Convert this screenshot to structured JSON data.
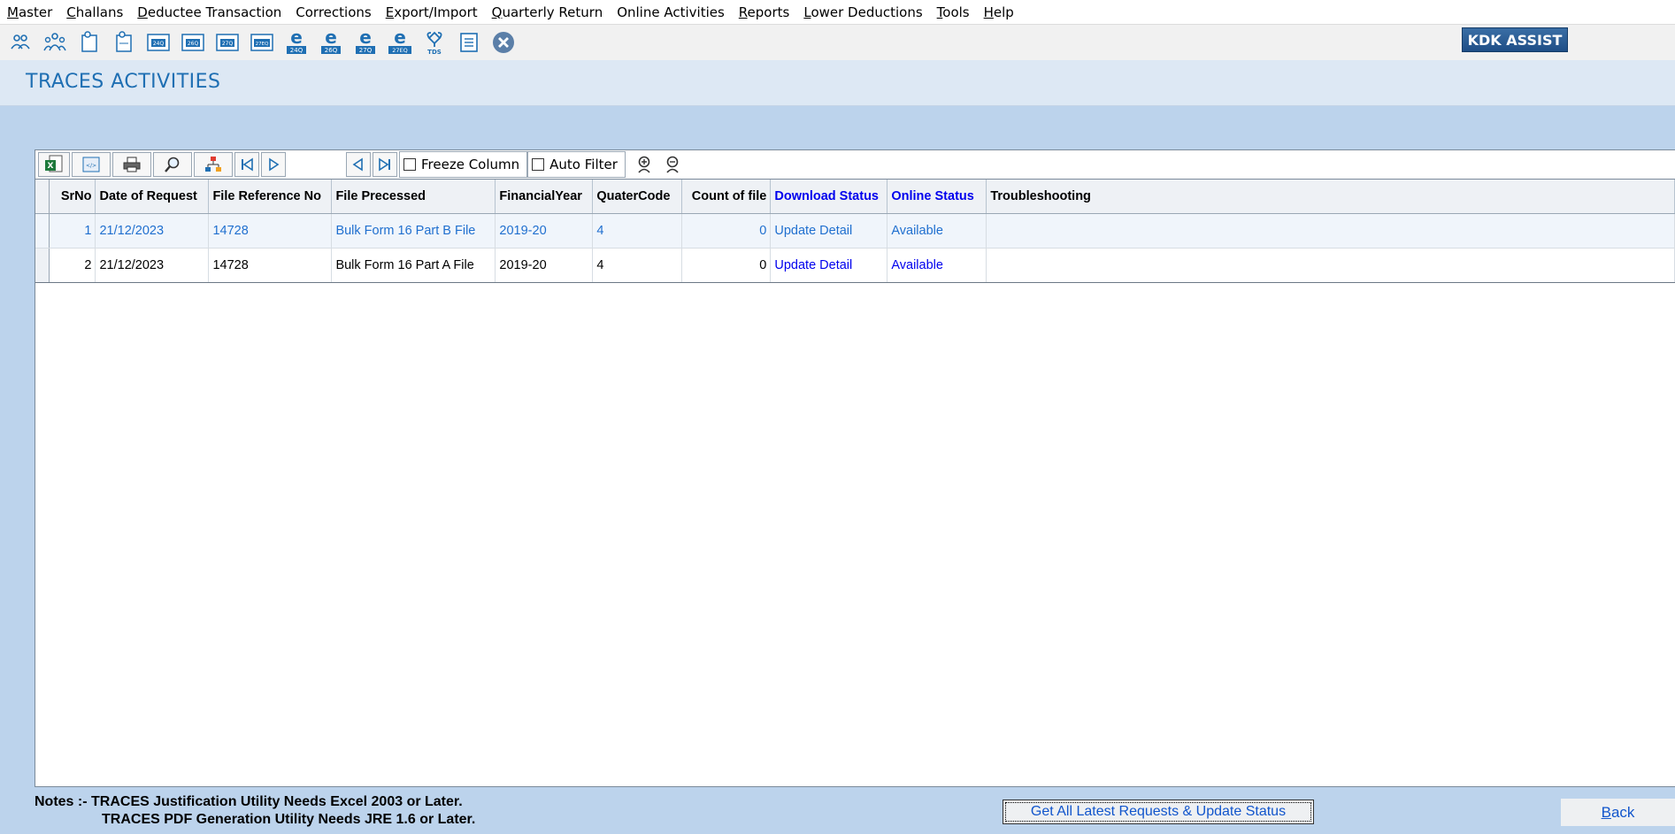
{
  "menu": [
    {
      "accel": "M",
      "rest": "aster"
    },
    {
      "accel": "C",
      "rest": "hallans"
    },
    {
      "accel": "D",
      "rest": "eductee Transaction"
    },
    {
      "accel": "",
      "rest": "Corrections"
    },
    {
      "accel": "E",
      "rest": "xport/Import"
    },
    {
      "accel": "Q",
      "rest": "uarterly Return"
    },
    {
      "accel": "",
      "rest": "Online Activities"
    },
    {
      "accel": "R",
      "rest": "eports"
    },
    {
      "accel": "L",
      "rest": "ower Deductions"
    },
    {
      "accel": "T",
      "rest": "ools"
    },
    {
      "accel": "H",
      "rest": "elp"
    }
  ],
  "toolbar": {
    "icons": [
      "deductor-icon",
      "deductee-icon",
      "user-doc-icon",
      "user-doc-2-icon",
      "form-24q-icon",
      "form-26q-icon",
      "form-27q-icon",
      "form-27eq-icon",
      "e-return-24q-icon",
      "e-return-26q-icon",
      "e-return-27q-icon",
      "e-return-27eq-icon",
      "tds-icon",
      "notes-icon",
      "close-icon"
    ],
    "icon_labels": [
      "",
      "",
      "",
      "",
      "24Q",
      "26Q",
      "27Q",
      "27EQ",
      "24Q",
      "26Q",
      "27Q",
      "27EQ",
      "TDS",
      "",
      ""
    ],
    "assist_label": "KDK ASSIST"
  },
  "page": {
    "title": "TRACES ACTIVITIES"
  },
  "grid_toolbar": {
    "freeze_label": "Freeze Column",
    "filter_label": "Auto Filter"
  },
  "grid": {
    "columns": [
      "SrNo",
      "Date of Request",
      "File Reference No",
      "File Precessed",
      "FinancialYear",
      "QuaterCode",
      "Count of file",
      "Download Status",
      "Online Status",
      "Troubleshooting"
    ],
    "rows": [
      {
        "srno": "1",
        "date": "21/12/2023",
        "ref": "14728",
        "file": "Bulk Form 16 Part B File",
        "fy": "2019-20",
        "qc": "4",
        "count": "0",
        "download": "Update Detail",
        "online": "Available",
        "trouble": ""
      },
      {
        "srno": "2",
        "date": "21/12/2023",
        "ref": "14728",
        "file": "Bulk Form 16 Part A File",
        "fy": "2019-20",
        "qc": "4",
        "count": "0",
        "download": "Update Detail",
        "online": "Available",
        "trouble": ""
      }
    ]
  },
  "footer": {
    "note_line1": "Notes :- TRACES Justification Utility Needs Excel 2003 or Later.",
    "note_line2": "TRACES PDF Generation Utility Needs JRE 1.6 or Later.",
    "refresh_label": "Get All Latest Requests & Update Status",
    "back_accel": "B",
    "back_rest": "ack"
  },
  "colors": {
    "accent": "#1f6fb3",
    "link": "#0000ee",
    "background": "#bcd3ec"
  }
}
